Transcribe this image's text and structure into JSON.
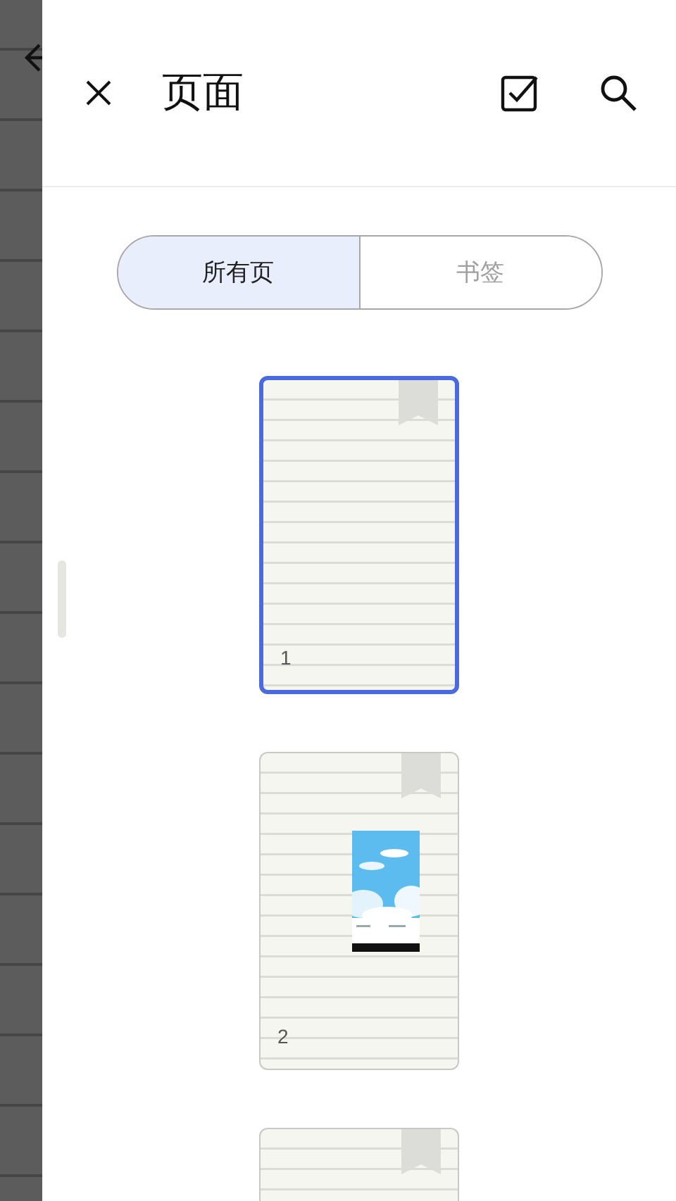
{
  "header": {
    "title": "页面"
  },
  "tabs": [
    {
      "label": "所有页",
      "selected": true
    },
    {
      "label": "书签",
      "selected": false
    }
  ],
  "pages": [
    {
      "number": "1",
      "selected": true
    },
    {
      "number": "2",
      "selected": false
    },
    {
      "selected": false
    }
  ]
}
